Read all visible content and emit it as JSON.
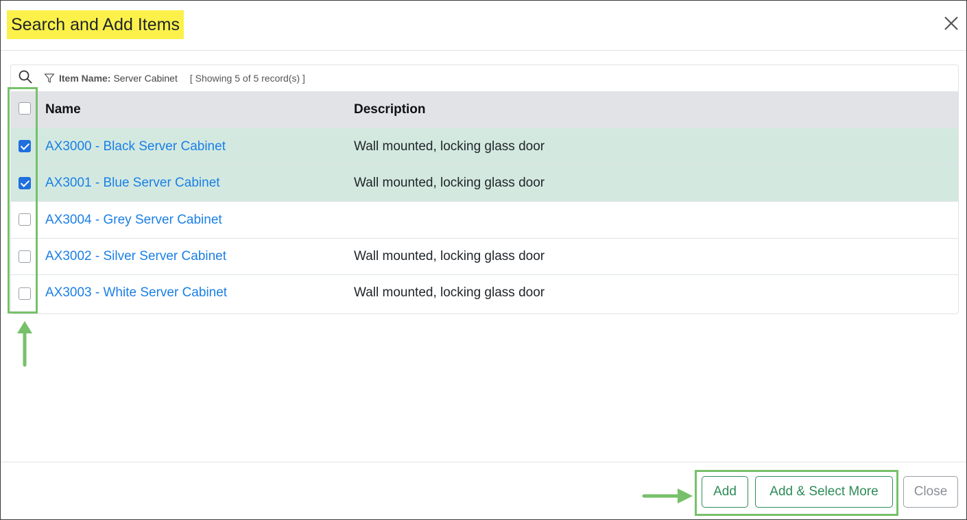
{
  "dialog": {
    "title": "Search and Add Items"
  },
  "filter": {
    "label": "Item Name:",
    "value": "Server Cabinet",
    "record_count": "[ Showing 5 of 5 record(s) ]"
  },
  "table": {
    "columns": [
      "Name",
      "Description"
    ],
    "rows": [
      {
        "name": "AX3000 - Black Server Cabinet",
        "description": "Wall mounted, locking glass door",
        "checked": true
      },
      {
        "name": "AX3001 - Blue Server Cabinet",
        "description": "Wall mounted, locking glass door",
        "checked": true
      },
      {
        "name": "AX3004 - Grey Server Cabinet",
        "description": "",
        "checked": false
      },
      {
        "name": "AX3002 - Silver Server Cabinet",
        "description": "Wall mounted, locking glass door",
        "checked": false
      },
      {
        "name": "AX3003 - White Server Cabinet",
        "description": "Wall mounted, locking glass door",
        "checked": false
      }
    ]
  },
  "footer": {
    "add_label": "Add",
    "add_select_more_label": "Add & Select More",
    "close_label": "Close"
  },
  "icons": {
    "search": "search-icon",
    "filter": "filter-icon",
    "close": "close-icon"
  },
  "colors": {
    "title_highlight": "#fbf14a",
    "link": "#1a7fe6",
    "selected_row": "#d3e9e0",
    "annotation": "#77c06a",
    "success": "#2e8b57",
    "checkbox_checked": "#1f6fde"
  }
}
